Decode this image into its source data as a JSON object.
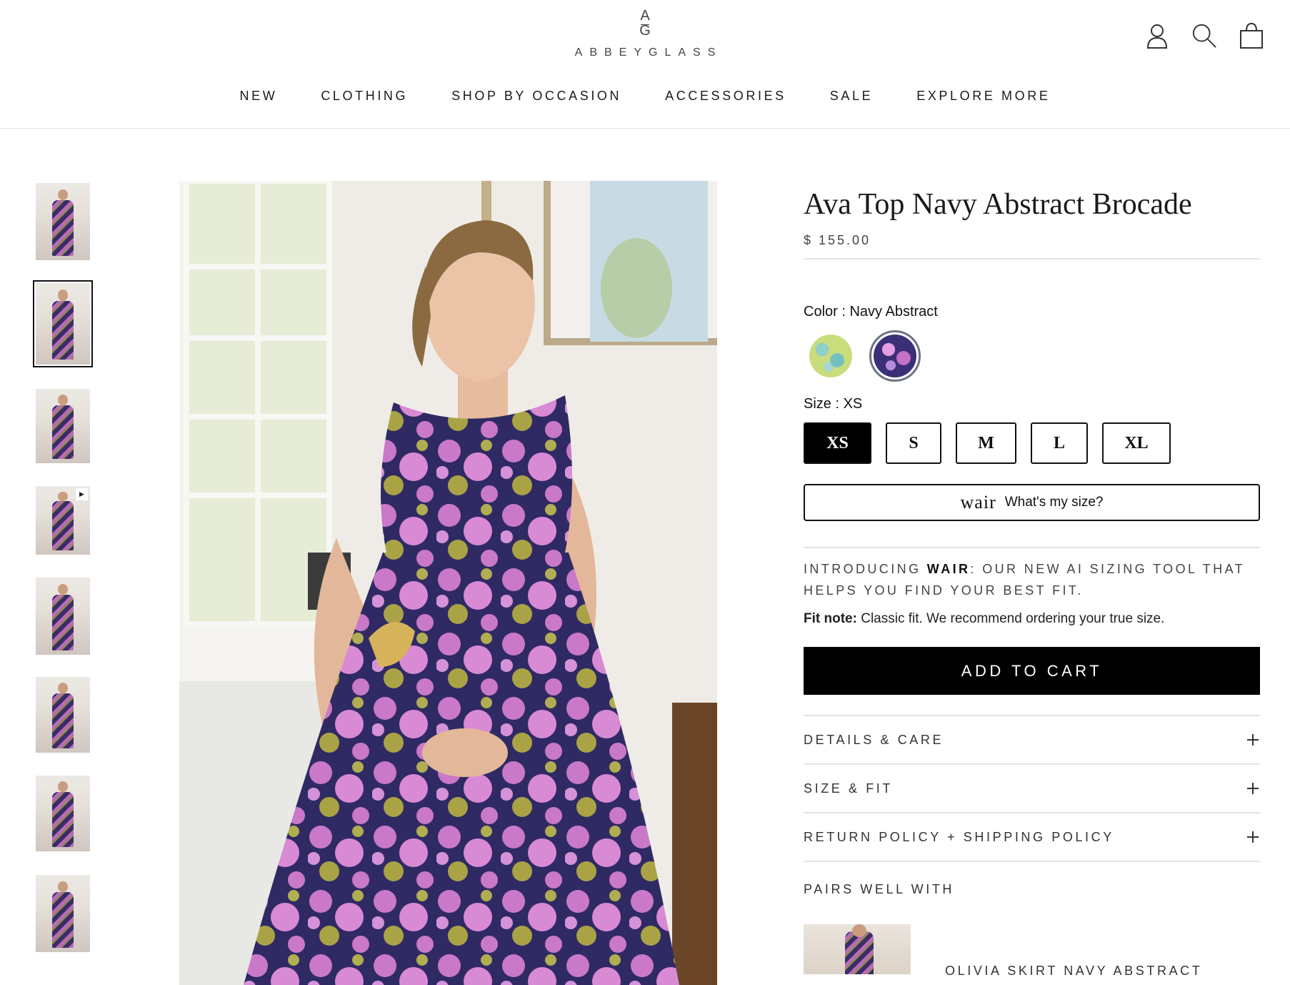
{
  "brand": {
    "logo_mark_top": "A",
    "logo_mark_bottom": "G",
    "wordmark": "ABBEYGLASS"
  },
  "header_icons": [
    "account-icon",
    "search-icon",
    "bag-icon"
  ],
  "nav": {
    "items": [
      "NEW",
      "CLOTHING",
      "SHOP BY OCCASION",
      "ACCESSORIES",
      "SALE",
      "EXPLORE MORE"
    ]
  },
  "gallery": {
    "thumbnail_count": 8,
    "active_thumbnail": 2,
    "video_thumbnail": 4
  },
  "product": {
    "title": "Ava Top Navy Abstract Brocade",
    "price": "$ 155.00",
    "color_label": "Color : Navy Abstract",
    "color_swatches": [
      "green-abstract-swatch",
      "navy-abstract-swatch"
    ],
    "selected_color": "Navy Abstract",
    "size_label": "Size : XS",
    "sizes": [
      "XS",
      "S",
      "M",
      "L",
      "XL"
    ],
    "selected_size": "XS",
    "wair_logo": "wair",
    "wair_button": "What's my size?",
    "intro_prefix": "INTRODUCING ",
    "intro_brand": "WAIR",
    "intro_suffix": ": OUR NEW AI SIZING TOOL THAT HELPS YOU FIND YOUR BEST FIT.",
    "fit_note_label": "Fit note:",
    "fit_note_text": " Classic fit. We recommend ordering your true size.",
    "add_to_cart": "ADD TO CART",
    "accordions": [
      "DETAILS & CARE",
      "SIZE & FIT",
      "RETURN POLICY + SHIPPING POLICY"
    ],
    "pairs_title": "PAIRS WELL WITH",
    "pair_item": "OLIVIA SKIRT NAVY ABSTRACT"
  },
  "colors": {
    "accent": "#000000",
    "divider": "#e3e3e3",
    "swatch_ring": "#6a7584"
  }
}
